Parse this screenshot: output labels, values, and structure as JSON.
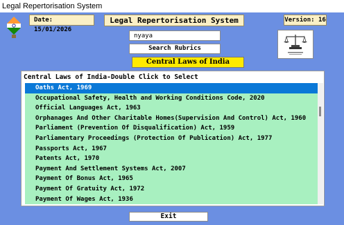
{
  "window": {
    "title": "Legal Repertorisation System"
  },
  "header": {
    "date_text": "Date: 15/01/2026",
    "app_title": "Legal Repertorisation System",
    "version_text": "Version: 16"
  },
  "search": {
    "value": "nyaya",
    "button_label": "Search Rubrics"
  },
  "section": {
    "title": "Central Laws of India"
  },
  "list": {
    "header": "Central Laws of India-Double Click to Select",
    "selected_index": 0,
    "items": [
      "Oaths Act, 1969",
      "Occupational Safety, Health and Working Conditions Code, 2020",
      "Official Languages Act, 1963",
      "Orphanages And Other Charitable Homes(Supervision And Control) Act, 1960",
      "Parliament (Prevention Of Disqualification) Act, 1959",
      "Parliamentary Proceedings (Protection Of Publication) Act, 1977",
      "Passports Act, 1967",
      "Patents Act, 1970",
      "Payment And Settlement Systems Act, 2007",
      "Payment Of Bonus Act, 1965",
      "Payment Of Gratuity Act, 1972",
      "Payment Of Wages Act, 1936"
    ]
  },
  "footer": {
    "exit_label": "Exit"
  },
  "colors": {
    "background": "#6b8fe2",
    "label_bg": "#fbf0c6",
    "section_bg": "#ffea00",
    "list_bg": "#a8f0c0",
    "selection": "#0a78d7"
  },
  "icons": {
    "emblem": "india-emblem-icon",
    "logo": "justice-scales-icon"
  }
}
